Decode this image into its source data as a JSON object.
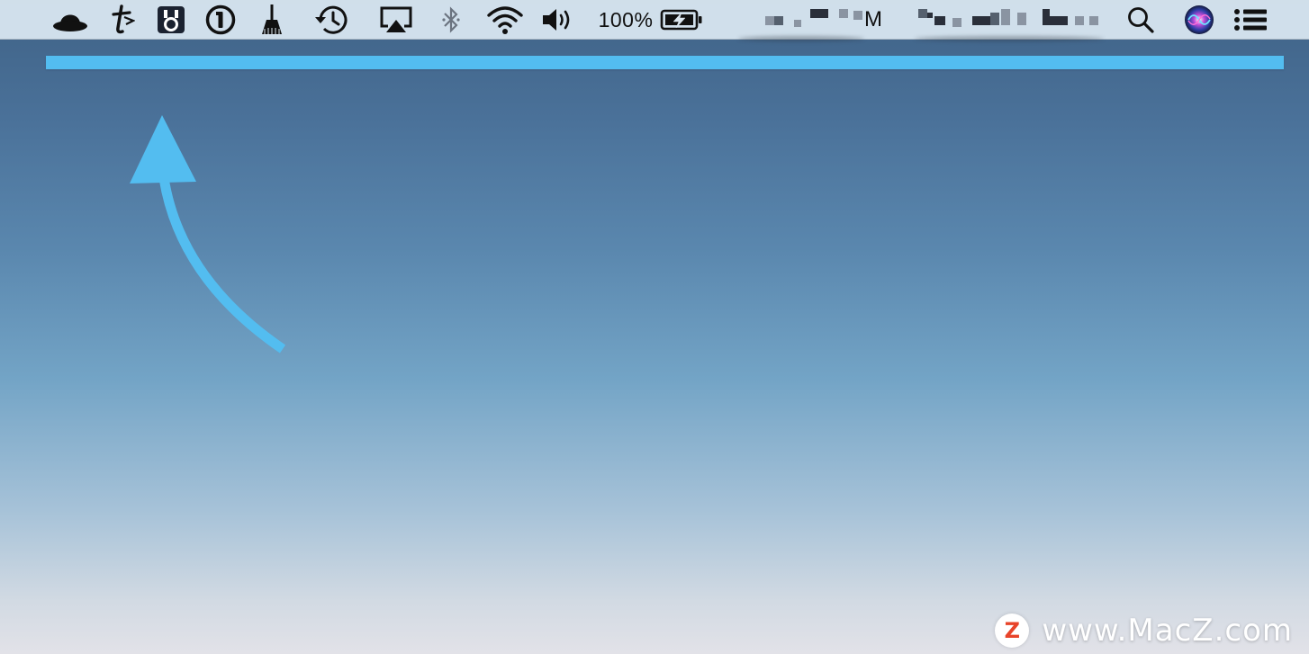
{
  "menubar": {
    "status_icons": [
      {
        "name": "bowler-hat-icon"
      },
      {
        "name": "typeeto-icon"
      },
      {
        "name": "padlock-app-icon"
      },
      {
        "name": "onepassword-icon"
      },
      {
        "name": "broom-cleaner-icon"
      },
      {
        "name": "time-machine-icon"
      },
      {
        "name": "airplay-icon"
      },
      {
        "name": "bluetooth-icon"
      },
      {
        "name": "wifi-icon"
      },
      {
        "name": "volume-icon"
      }
    ],
    "battery_percent": "100%",
    "clock_visible_suffix": "M",
    "right_icons": [
      "spotlight-search-icon",
      "siri-icon",
      "notification-center-icon"
    ]
  },
  "annotation": {
    "highlight_color": "#53bdf0",
    "arrow_color": "#53bdf0"
  },
  "watermark": {
    "logo_letter": "Z",
    "text": "www.MacZ.com"
  }
}
